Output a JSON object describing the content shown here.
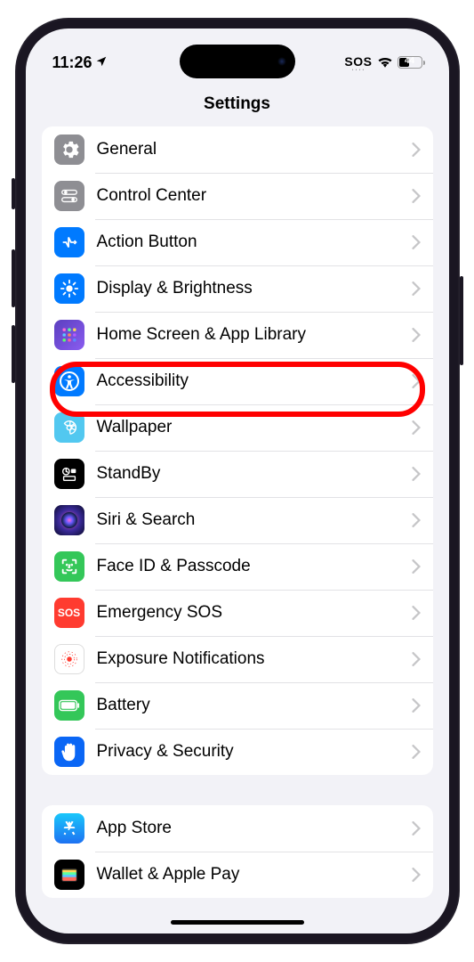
{
  "status": {
    "time": "11:26",
    "sos": "SOS",
    "battery_pct": "44"
  },
  "header": {
    "title": "Settings"
  },
  "groups": [
    {
      "rows": [
        {
          "label": "General",
          "icon": "gear-icon"
        },
        {
          "label": "Control Center",
          "icon": "switches-icon"
        },
        {
          "label": "Action Button",
          "icon": "action-button-icon"
        },
        {
          "label": "Display & Brightness",
          "icon": "brightness-icon"
        },
        {
          "label": "Home Screen & App Library",
          "icon": "home-screen-icon"
        },
        {
          "label": "Accessibility",
          "icon": "accessibility-icon",
          "highlighted": true
        },
        {
          "label": "Wallpaper",
          "icon": "wallpaper-icon"
        },
        {
          "label": "StandBy",
          "icon": "standby-icon"
        },
        {
          "label": "Siri & Search",
          "icon": "siri-icon"
        },
        {
          "label": "Face ID & Passcode",
          "icon": "faceid-icon"
        },
        {
          "label": "Emergency SOS",
          "icon": "sos-icon"
        },
        {
          "label": "Exposure Notifications",
          "icon": "exposure-icon"
        },
        {
          "label": "Battery",
          "icon": "battery-icon"
        },
        {
          "label": "Privacy & Security",
          "icon": "privacy-icon"
        }
      ]
    },
    {
      "rows": [
        {
          "label": "App Store",
          "icon": "appstore-icon"
        },
        {
          "label": "Wallet & Apple Pay",
          "icon": "wallet-icon"
        }
      ]
    }
  ]
}
